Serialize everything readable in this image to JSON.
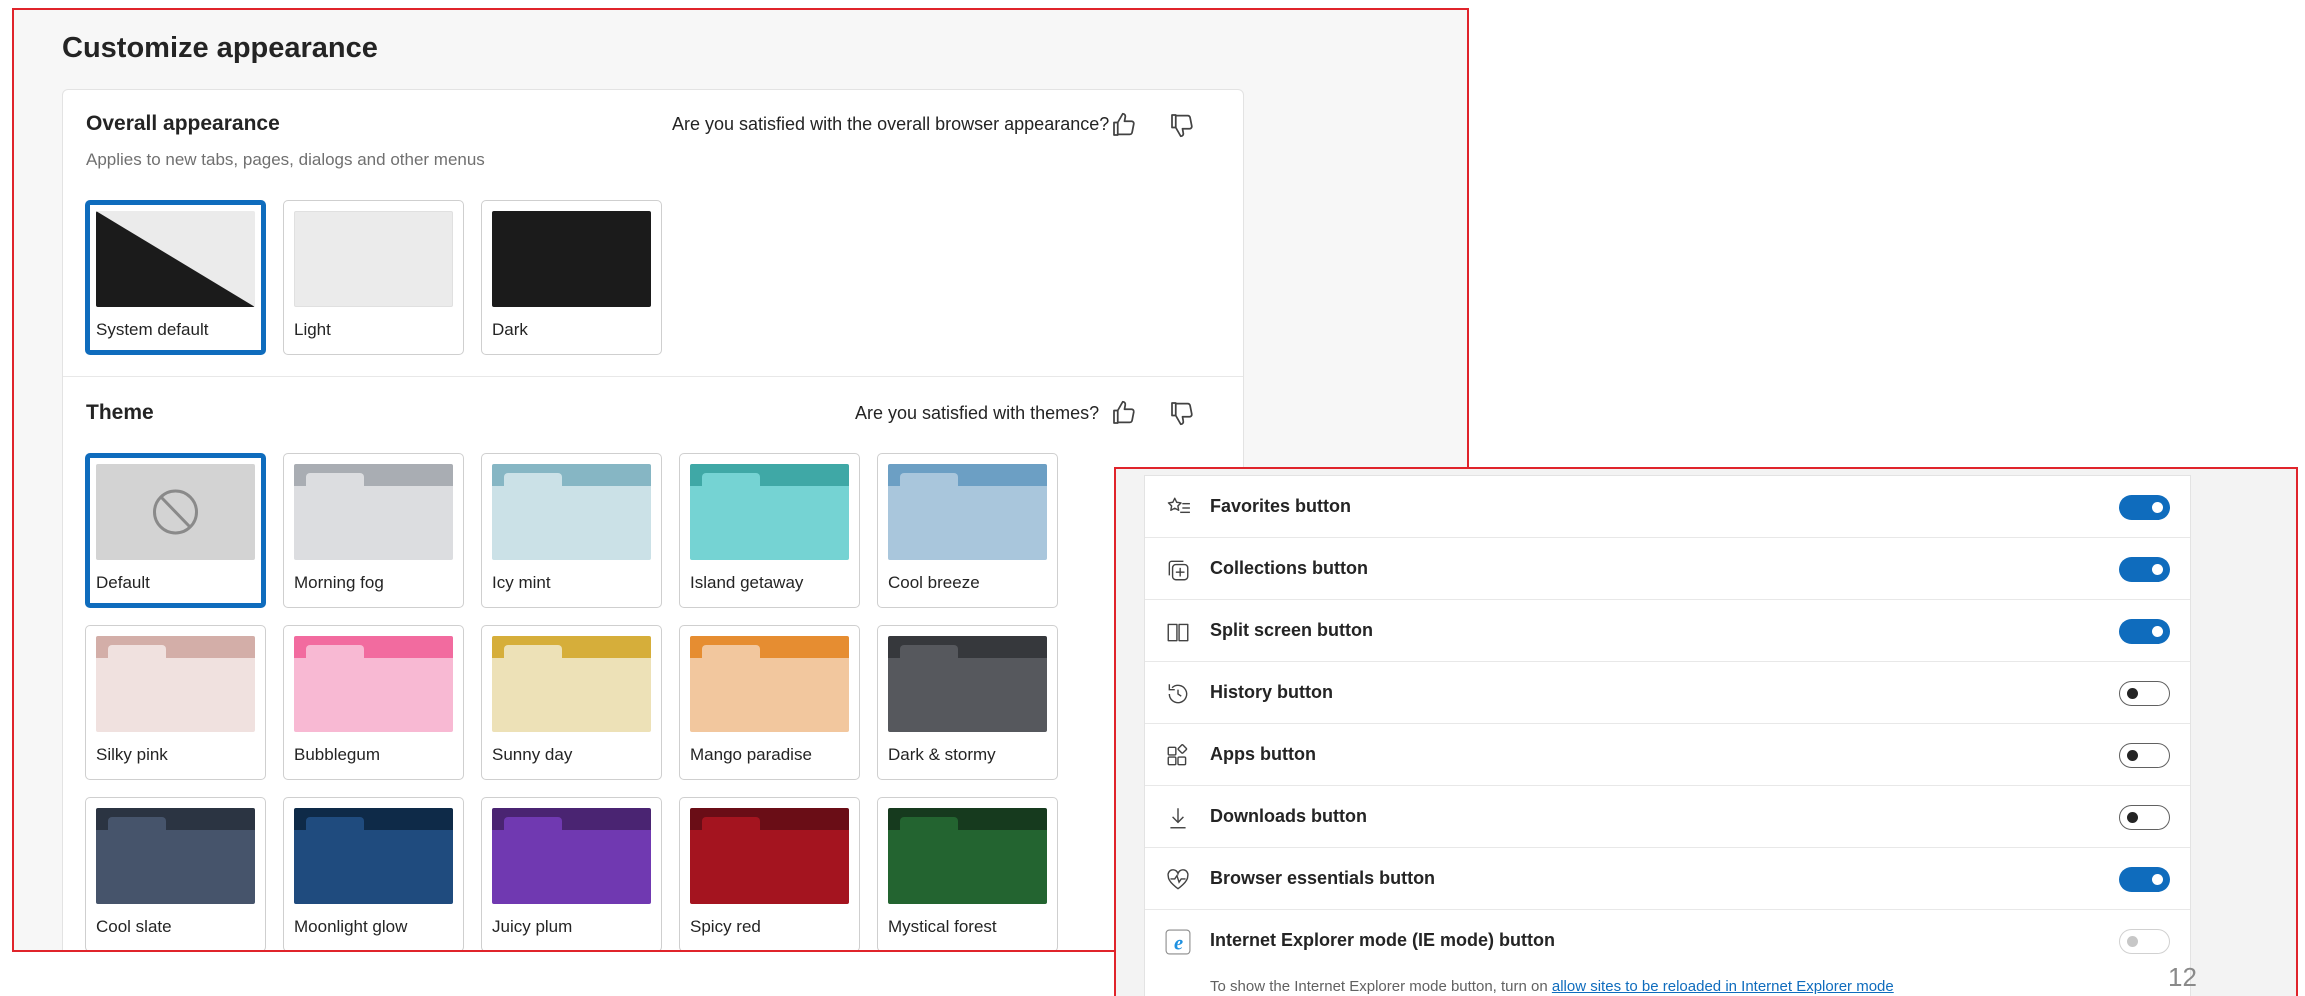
{
  "page": {
    "title": "Customize appearance",
    "slide_number": "12"
  },
  "overall": {
    "title": "Overall appearance",
    "subtitle": "Applies to new tabs, pages, dialogs and other menus",
    "feedback_question": "Are you satisfied with the overall browser appearance?",
    "options": [
      {
        "label": "System default",
        "selected": true
      },
      {
        "label": "Light",
        "selected": false
      },
      {
        "label": "Dark",
        "selected": false
      }
    ]
  },
  "theme": {
    "title": "Theme",
    "feedback_question": "Are you satisfied with themes?",
    "options": [
      {
        "label": "Default",
        "selected": true,
        "icon": "no-symbol-icon",
        "bar": "#d3d3d3",
        "tab": "#d3d3d3",
        "body": "#d3d3d3"
      },
      {
        "label": "Morning fog",
        "selected": false,
        "bar": "#a9adb3",
        "tab": "#dcdde0",
        "body": "#dcdde0"
      },
      {
        "label": "Icy mint",
        "selected": false,
        "bar": "#86b6c4",
        "tab": "#cbe1e7",
        "body": "#cbe1e7"
      },
      {
        "label": "Island getaway",
        "selected": false,
        "bar": "#3fa8a6",
        "tab": "#75d3d3",
        "body": "#75d3d3"
      },
      {
        "label": "Cool breeze",
        "selected": false,
        "bar": "#6c9fc4",
        "tab": "#a9c6dc",
        "body": "#a9c6dc"
      },
      {
        "label": "Silky pink",
        "selected": false,
        "bar": "#d3aea8",
        "tab": "#f0e1df",
        "body": "#f0e1df"
      },
      {
        "label": "Bubblegum",
        "selected": false,
        "bar": "#f26b9f",
        "tab": "#f8b9d3",
        "body": "#f8b9d3"
      },
      {
        "label": "Sunny day",
        "selected": false,
        "bar": "#d6ae3a",
        "tab": "#ede1b7",
        "body": "#ede1b7"
      },
      {
        "label": "Mango paradise",
        "selected": false,
        "bar": "#e68d31",
        "tab": "#f2c79e",
        "body": "#f2c79e"
      },
      {
        "label": "Dark & stormy",
        "selected": false,
        "bar": "#36383c",
        "tab": "#56585d",
        "body": "#56585d"
      },
      {
        "label": "Cool slate",
        "selected": false,
        "bar": "#2b3442",
        "tab": "#46546b",
        "body": "#46546b"
      },
      {
        "label": "Moonlight glow",
        "selected": false,
        "bar": "#0e2a48",
        "tab": "#1f4b7e",
        "body": "#1f4b7e"
      },
      {
        "label": "Juicy plum",
        "selected": false,
        "bar": "#4a2472",
        "tab": "#7039b1",
        "body": "#7039b1"
      },
      {
        "label": "Spicy red",
        "selected": false,
        "bar": "#6a0d16",
        "tab": "#a4141f",
        "body": "#a4141f"
      },
      {
        "label": "Mystical forest",
        "selected": false,
        "bar": "#163a1e",
        "tab": "#236430",
        "body": "#236430"
      }
    ]
  },
  "toolbar_buttons": {
    "items": [
      {
        "label": "Favorites button",
        "icon": "favorites-icon",
        "state": "on"
      },
      {
        "label": "Collections button",
        "icon": "collections-icon",
        "state": "on"
      },
      {
        "label": "Split screen button",
        "icon": "split-screen-icon",
        "state": "on"
      },
      {
        "label": "History button",
        "icon": "history-icon",
        "state": "off"
      },
      {
        "label": "Apps button",
        "icon": "apps-icon",
        "state": "off"
      },
      {
        "label": "Downloads button",
        "icon": "downloads-icon",
        "state": "off"
      },
      {
        "label": "Browser essentials button",
        "icon": "browser-essentials-icon",
        "state": "on"
      },
      {
        "label": "Internet Explorer mode (IE mode) button",
        "icon": "ie-mode-icon",
        "state": "disabled"
      }
    ],
    "ie_note_prefix": "To show the Internet Explorer mode button, turn on ",
    "ie_note_link": "allow sites to be reloaded in Internet Explorer mode"
  },
  "colors": {
    "accent": "#0f6cbd",
    "frame_border": "#e0242b"
  }
}
